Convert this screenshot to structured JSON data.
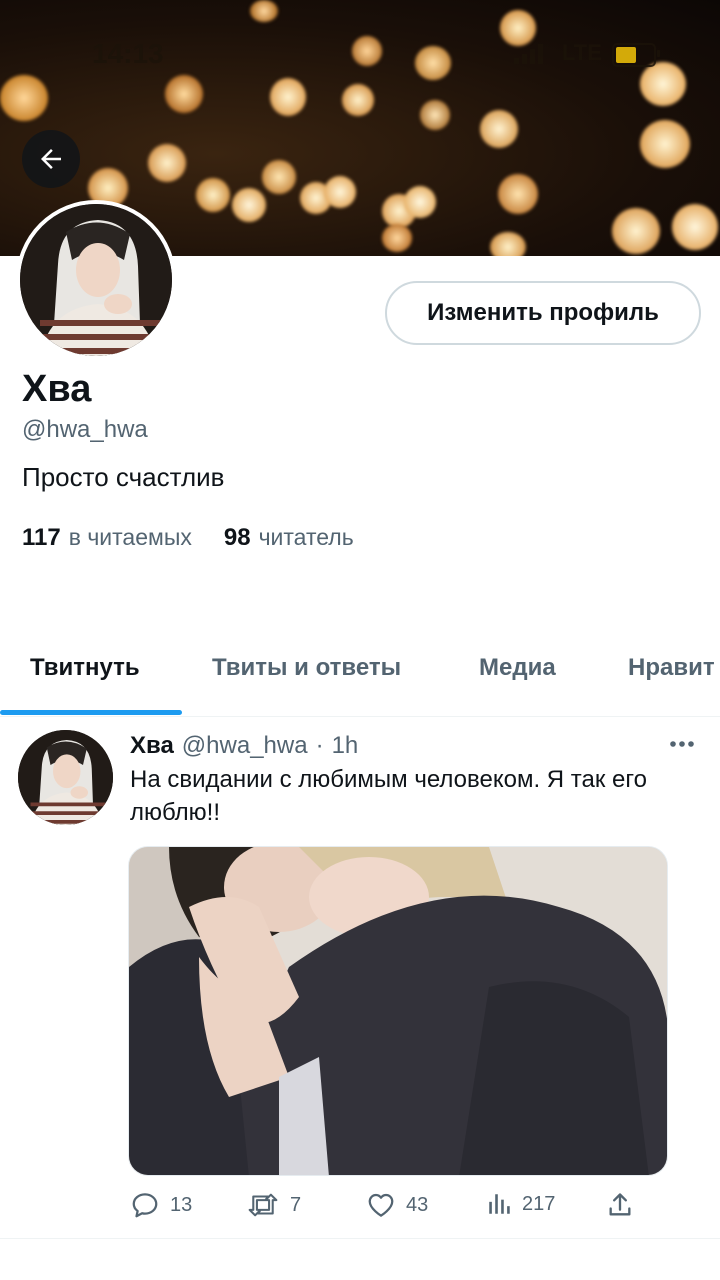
{
  "status_bar": {
    "time": "14:13",
    "network": "LTE"
  },
  "profile": {
    "display_name": "Хва",
    "handle": "@hwa_hwa",
    "bio": "Просто счастлив",
    "following_count": "117",
    "following_label": "в читаемых",
    "followers_count": "98",
    "followers_label": "читатель",
    "edit_button_label": "Изменить профиль"
  },
  "tabs": [
    {
      "label": "Твитнуть",
      "active": true
    },
    {
      "label": "Твиты и ответы",
      "active": false
    },
    {
      "label": "Медиа",
      "active": false
    },
    {
      "label": "Нравит",
      "active": false
    }
  ],
  "tweet": {
    "author": "Хва",
    "handle": "@hwa_hwa",
    "separator": "·",
    "time": "1h",
    "text": "На свидании с любимым человеком. Я так его люблю!!",
    "replies": "13",
    "retweets": "7",
    "likes": "43",
    "views": "217"
  },
  "colors": {
    "accent": "#1d9bf0",
    "muted": "#536471",
    "text": "#0f1419"
  },
  "icons": [
    "back-arrow-icon",
    "more-icon",
    "reply-icon",
    "retweet-icon",
    "like-icon",
    "views-icon",
    "share-icon"
  ]
}
